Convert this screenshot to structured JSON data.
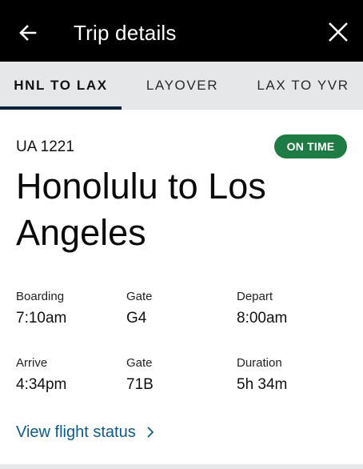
{
  "header": {
    "title": "Trip details",
    "back_icon": "arrow-left-icon",
    "close_icon": "close-icon"
  },
  "tabs": [
    {
      "label": "HNL TO LAX",
      "selected": true
    },
    {
      "label": "LAYOVER",
      "selected": false
    },
    {
      "label": "LAX TO YVR",
      "selected": false
    }
  ],
  "flight": {
    "number": "UA 1221",
    "status": "ON TIME",
    "status_color": "#1d7b43",
    "route": "Honolulu to Los Angeles"
  },
  "details": {
    "row1": [
      {
        "label": "Boarding",
        "value": "7:10am"
      },
      {
        "label": "Gate",
        "value": "G4"
      },
      {
        "label": "Depart",
        "value": "8:00am"
      }
    ],
    "row2": [
      {
        "label": "Arrive",
        "value": "4:34pm"
      },
      {
        "label": "Gate",
        "value": "71B"
      },
      {
        "label": "Duration",
        "value": "5h 34m"
      }
    ]
  },
  "link": {
    "label": "View flight status",
    "icon": "chevron-right-icon",
    "color": "#0c5b87"
  },
  "colors": {
    "header_bg": "#000000",
    "tab_bg": "#e6e7e8",
    "tab_indicator": "#0c2340"
  }
}
